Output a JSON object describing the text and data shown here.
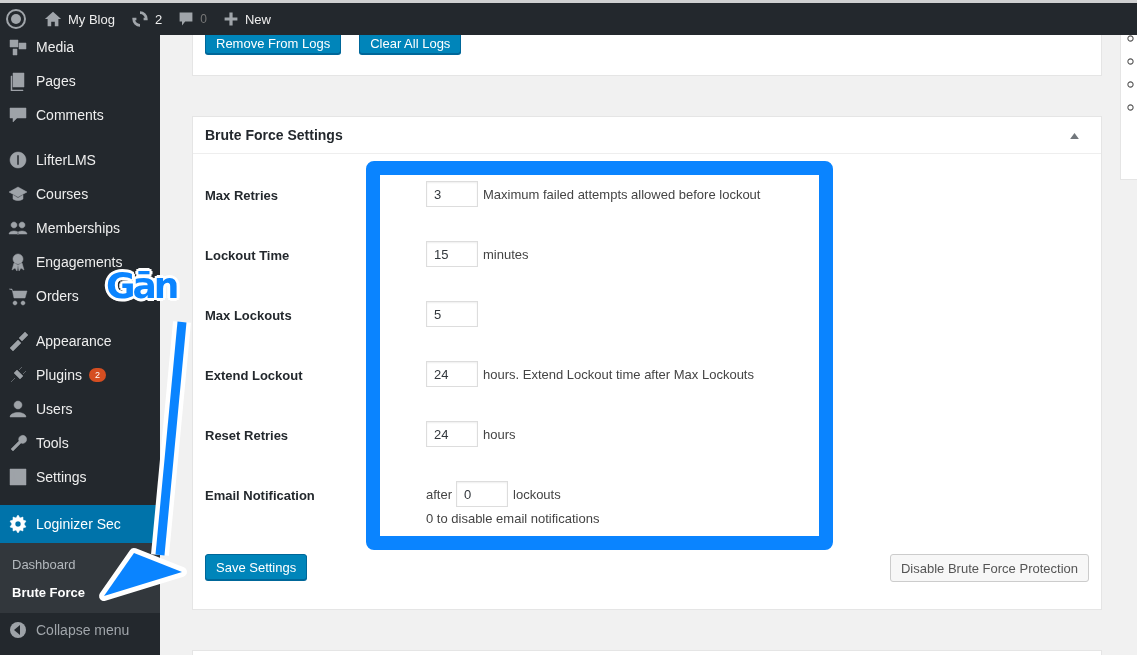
{
  "admin_bar": {
    "site": "My Blog",
    "updates": "2",
    "comments": "0",
    "new": "New"
  },
  "sidebar": {
    "groups": [
      [
        {
          "label": "Media",
          "selected": false
        },
        {
          "label": "Pages",
          "selected": false
        },
        {
          "label": "Comments",
          "selected": false
        }
      ],
      [
        {
          "label": "LifterLMS",
          "selected": false
        },
        {
          "label": "Courses",
          "selected": false
        },
        {
          "label": "Memberships",
          "selected": false
        },
        {
          "label": "Engagements",
          "selected": false
        },
        {
          "label": "Orders",
          "selected": false
        }
      ],
      [
        {
          "label": "Appearance",
          "selected": false
        },
        {
          "label": "Plugins",
          "selected": false,
          "badge": "2"
        },
        {
          "label": "Users",
          "selected": false
        },
        {
          "label": "Tools",
          "selected": false
        },
        {
          "label": "Settings",
          "selected": false
        }
      ],
      [
        {
          "label": "Loginizer Sec",
          "selected": true,
          "children": [
            {
              "label": "Dashboard",
              "selected": false
            },
            {
              "label": "Brute Force",
              "selected": true
            }
          ]
        }
      ]
    ],
    "collapse": "Collapse menu"
  },
  "logs_card": {
    "buttons": [
      "Remove From Logs",
      "Clear All Logs"
    ]
  },
  "settings_card": {
    "title": "Brute Force Settings",
    "expanded": true,
    "rows": [
      {
        "kind": "field",
        "label": "Max Retries",
        "value": "3",
        "note": "Maximum failed attempts allowed before lockout"
      },
      {
        "kind": "field",
        "label": "Lockout Time",
        "value": "15",
        "note": "minutes"
      },
      {
        "kind": "field",
        "label": "Max Lockouts",
        "value": "5"
      },
      {
        "kind": "field",
        "label": "Extend Lockout",
        "value": "24",
        "note": "hours. Extend Lockout time after Max Lockouts"
      },
      {
        "kind": "field",
        "label": "Reset Retries",
        "value": "24",
        "note": "hours"
      },
      {
        "kind": "email",
        "label": "Email Notification",
        "prefix": "after",
        "value": "0",
        "note": "lockouts",
        "hint": "0 to disable email notifications"
      }
    ],
    "save": "Save Settings",
    "disable": "Disable Brute Force Protection"
  },
  "annotation": {
    "label": "Gān"
  }
}
